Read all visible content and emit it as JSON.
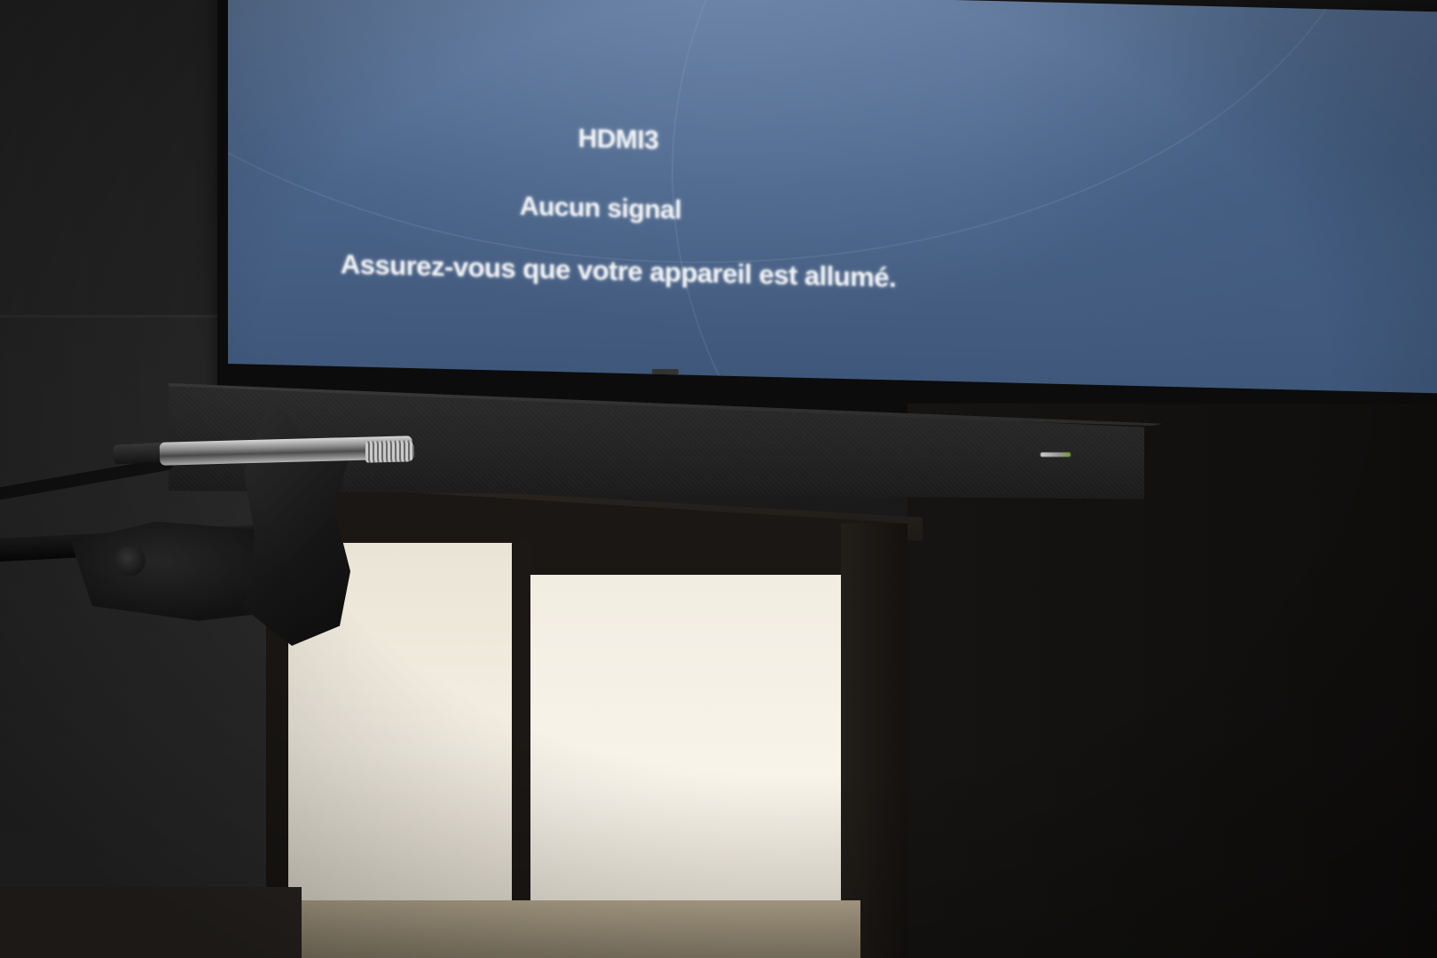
{
  "scene": {
    "description_alt": "Television showing a no-signal message above a soundbar, with a measurement microphone on a stand in the foreground"
  },
  "tv": {
    "input_name": "HDMI3",
    "status": "Aucun signal",
    "message": "Assurez-vous que votre appareil est allumé.",
    "screen_color": "#4a6489"
  },
  "soundbar": {
    "indicator_color": "#7a9d3a"
  },
  "colors": {
    "cabinet": "#1a1714",
    "cabinet_doors": "#f4efe3"
  }
}
